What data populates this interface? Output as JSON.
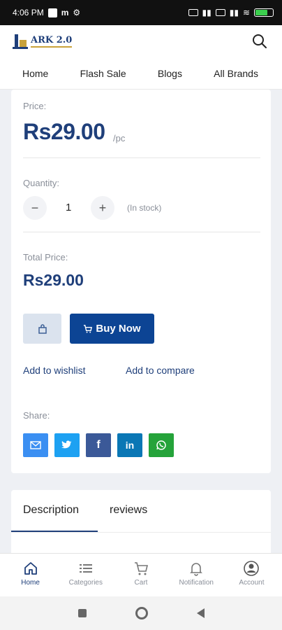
{
  "status_bar": {
    "time": "4:06 PM"
  },
  "header": {
    "logo_text": "ARK 2.0"
  },
  "nav": {
    "items": [
      "Home",
      "Flash Sale",
      "Blogs",
      "All Brands"
    ]
  },
  "product": {
    "price_label": "Price:",
    "price": "Rs29.00",
    "unit": "/pc",
    "quantity_label": "Quantity:",
    "quantity": "1",
    "stock": "(In stock)",
    "total_label": "Total Price:",
    "total": "Rs29.00",
    "buy_now": "Buy Now",
    "wishlist": "Add to wishlist",
    "compare": "Add to compare",
    "share_label": "Share:"
  },
  "share_buttons": [
    {
      "name": "email-icon",
      "color": "#3b8ff2"
    },
    {
      "name": "twitter-icon",
      "color": "#1da1f2"
    },
    {
      "name": "facebook-icon",
      "color": "#3b5998"
    },
    {
      "name": "linkedin-icon",
      "color": "#0a77b5"
    },
    {
      "name": "whatsapp-icon",
      "color": "#25a33a"
    }
  ],
  "tabs": [
    "Description",
    "reviews"
  ],
  "bottom_nav": [
    "Home",
    "Categories",
    "Cart",
    "Notification",
    "Account"
  ],
  "colors": {
    "primary": "#0c4494",
    "price": "#1f3f7a",
    "muted": "#8a8f99"
  }
}
